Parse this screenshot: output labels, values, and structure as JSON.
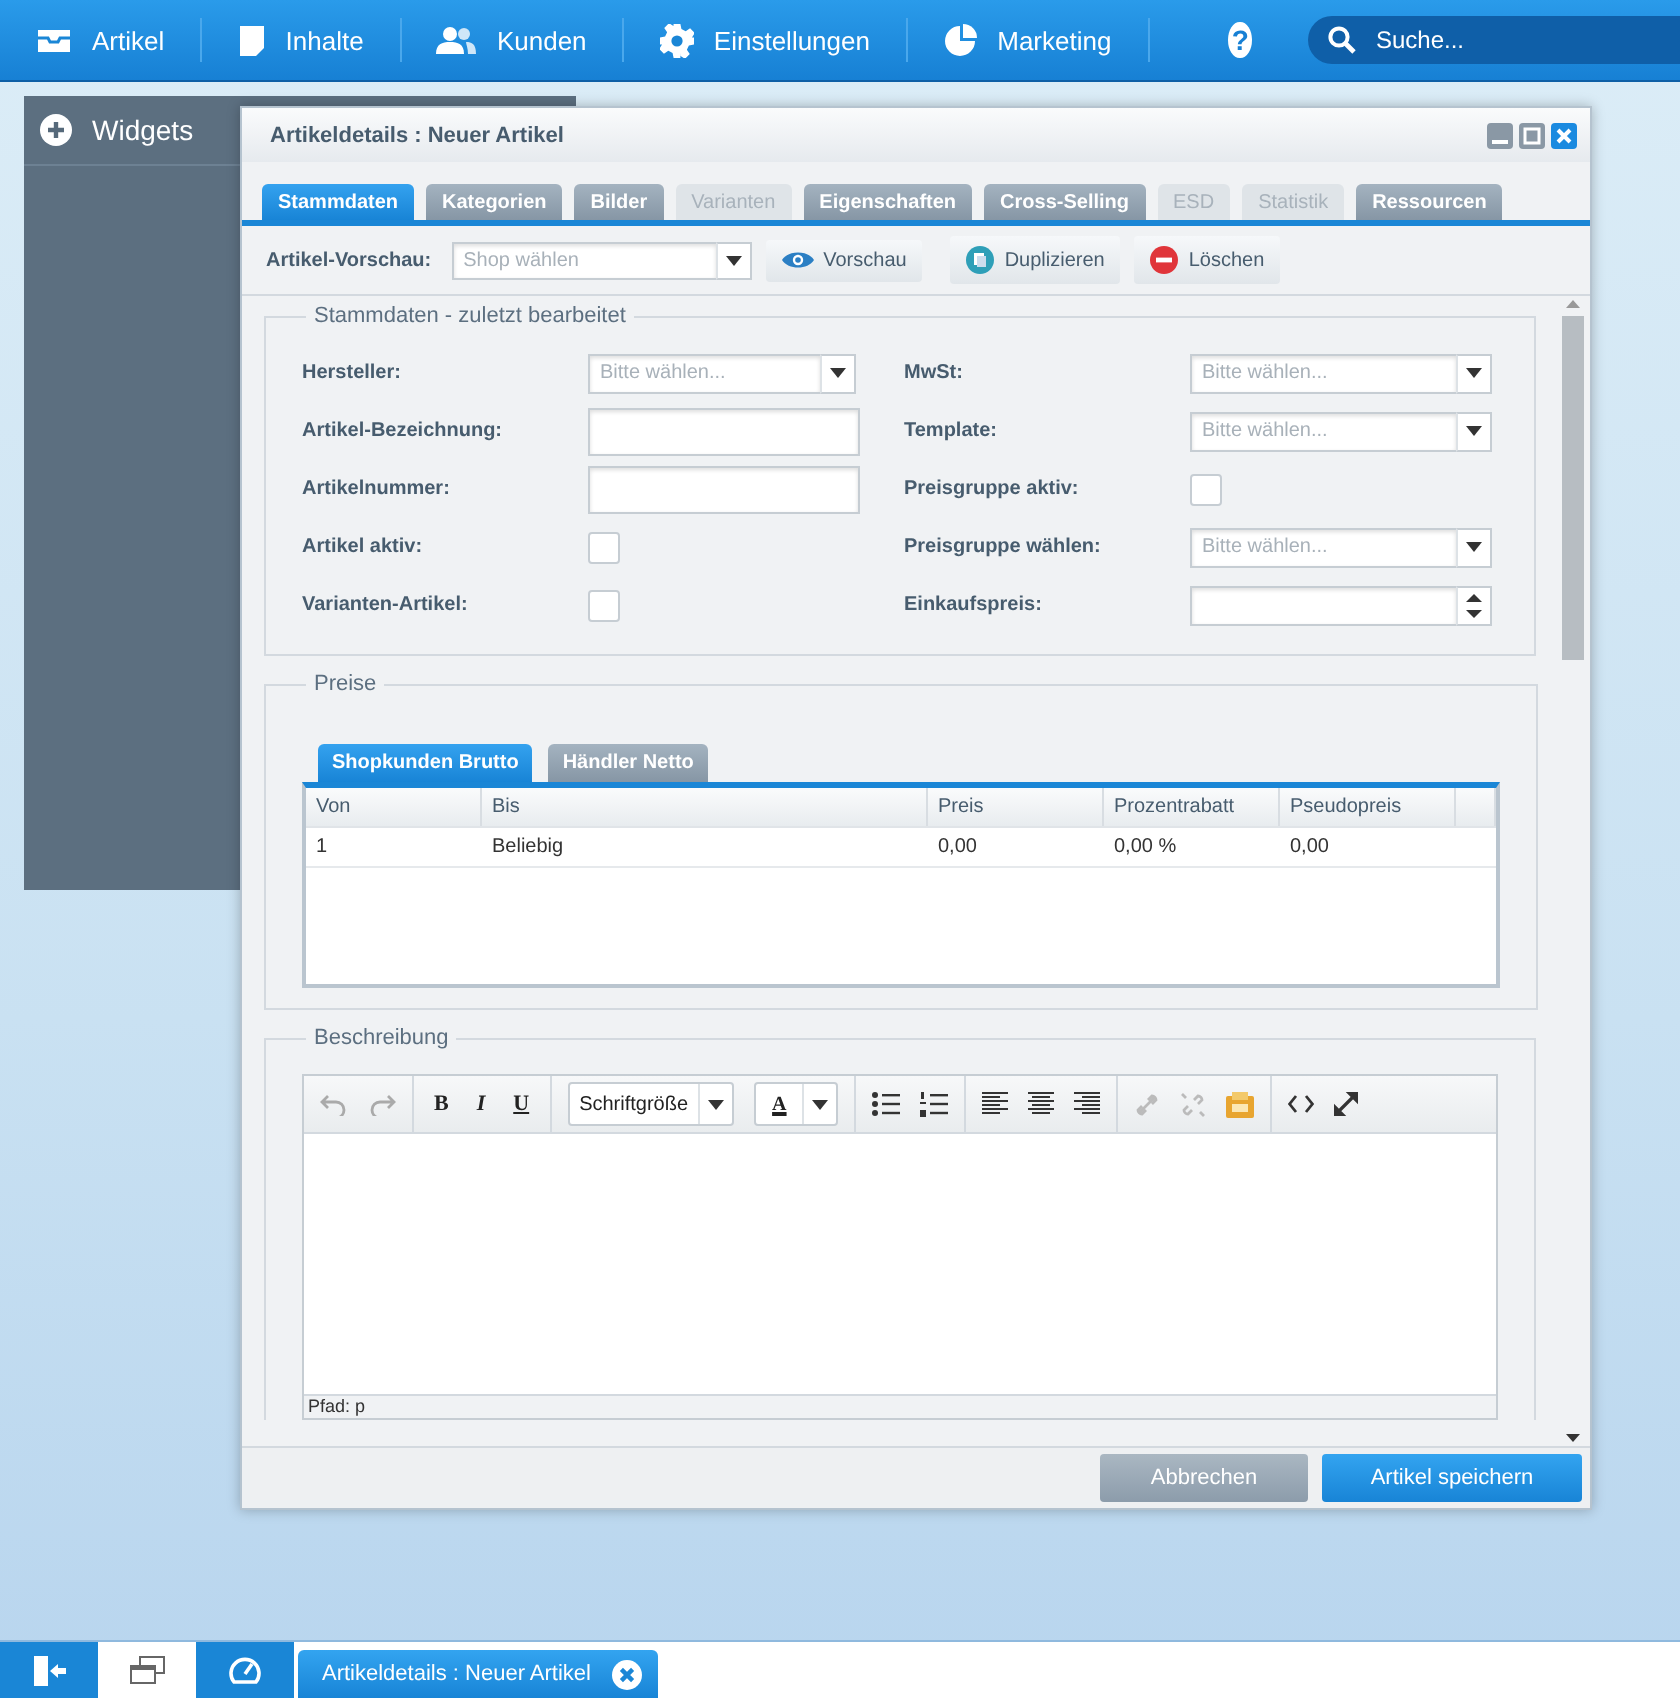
{
  "topnav": {
    "items": [
      {
        "label": "Artikel"
      },
      {
        "label": "Inhalte"
      },
      {
        "label": "Kunden"
      },
      {
        "label": "Einstellungen"
      },
      {
        "label": "Marketing"
      }
    ],
    "help": "?",
    "search": {
      "placeholder": "Suche..."
    }
  },
  "widgets": {
    "title": "Widgets"
  },
  "window": {
    "title": "Artikeldetails : Neuer Artikel",
    "tabs": [
      {
        "label": "Stammdaten",
        "selected": true,
        "disabled": false
      },
      {
        "label": "Kategorien",
        "selected": false,
        "disabled": false
      },
      {
        "label": "Bilder",
        "selected": false,
        "disabled": false
      },
      {
        "label": "Varianten",
        "selected": false,
        "disabled": true
      },
      {
        "label": "Eigenschaften",
        "selected": false,
        "disabled": false
      },
      {
        "label": "Cross-Selling",
        "selected": false,
        "disabled": false
      },
      {
        "label": "ESD",
        "selected": false,
        "disabled": true
      },
      {
        "label": "Statistik",
        "selected": false,
        "disabled": true
      },
      {
        "label": "Ressourcen",
        "selected": false,
        "disabled": false
      }
    ],
    "preview": {
      "label": "Artikel-Vorschau:",
      "shop": {
        "placeholder": "Shop wählen"
      },
      "buttons": [
        "Vorschau",
        "Duplizieren",
        "Löschen"
      ]
    },
    "stammdaten": {
      "legend": "Stammdaten - zuletzt bearbeitet",
      "left": [
        {
          "label": "Hersteller:",
          "kind": "select",
          "placeholder": "Bitte wählen..."
        },
        {
          "label": "Artikel-Bezeichnung:",
          "kind": "text"
        },
        {
          "label": "Artikelnummer:",
          "kind": "text"
        },
        {
          "label": "Artikel aktiv:",
          "kind": "checkbox",
          "checked": false
        },
        {
          "label": "Varianten-Artikel:",
          "kind": "checkbox",
          "checked": false
        }
      ],
      "right": [
        {
          "label": "MwSt:",
          "kind": "select",
          "placeholder": "Bitte wählen..."
        },
        {
          "label": "Template:",
          "kind": "select",
          "placeholder": "Bitte wählen..."
        },
        {
          "label": "Preisgruppe aktiv:",
          "kind": "checkbox",
          "checked": false
        },
        {
          "label": "Preisgruppe wählen:",
          "kind": "select",
          "placeholder": "Bitte wählen..."
        },
        {
          "label": "Einkaufspreis:",
          "kind": "number"
        }
      ]
    },
    "preise": {
      "legend": "Preise",
      "tabs": [
        {
          "label": "Shopkunden Brutto",
          "selected": true
        },
        {
          "label": "Händler Netto",
          "selected": false
        }
      ],
      "table": {
        "columns": [
          "Von",
          "Bis",
          "Preis",
          "Prozentrabatt",
          "Pseudopreis"
        ],
        "rows": [
          [
            "1",
            "Beliebig",
            "0,00",
            "0,00 %",
            "0,00"
          ]
        ]
      }
    },
    "beschreibung": {
      "legend": "Beschreibung",
      "format_buttons": [
        "B",
        "I",
        "U"
      ],
      "font_size": "Schriftgröße",
      "color_label": "A",
      "path": "Pfad: p"
    },
    "footer": {
      "buttons": [
        {
          "label": "Abbrechen",
          "kind": "secondary"
        },
        {
          "label": "Artikel speichern",
          "kind": "primary"
        }
      ]
    }
  },
  "taskbar": {
    "tasks": [
      {
        "label": "Artikeldetails : Neuer Artikel"
      }
    ]
  }
}
